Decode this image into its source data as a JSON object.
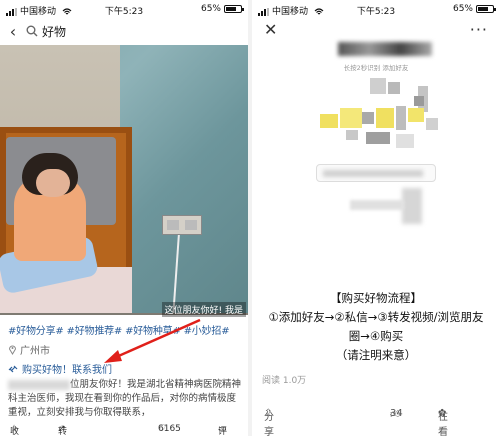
{
  "left": {
    "status": {
      "carrier": "中国移动",
      "time": "下午5:23",
      "battery": "65%"
    },
    "search": {
      "query": "好物"
    },
    "photo": {
      "caption": "这位朋友你好! 我是"
    },
    "tags": "#好物分享# #好物推荐# #好物种草# #小妙招#",
    "location": "广州市",
    "buy_link": "购买好物！联系我们",
    "description": "位朋友你好！我是湖北省精神病医院精神科主治医师，我现在看到你的作品后，对你的病情极度重视，立刻安排我与你取得联系，",
    "footer": {
      "favorite": "收藏",
      "share": "转发",
      "likes": "6165",
      "comments": "评"
    }
  },
  "right": {
    "status": {
      "carrier": "中国移动",
      "time": "下午5:23",
      "battery": "65%"
    },
    "ad_subtitle": "长按2秒识别    添加好友",
    "flow": {
      "title": "【购买好物流程】",
      "line1": "①添加好友→②私信→③转发视频/浏览朋友",
      "line2": "圈→④购买",
      "line3": "（请注明来意）"
    },
    "reads": "阅读 1.0万",
    "footer": {
      "share": "分享",
      "likes": "34",
      "watching": "在看 55"
    }
  },
  "colors": {
    "link": "#2b5e9a",
    "arrow": "#e0201a",
    "mosaic_yellow": "#f0e060"
  },
  "icons": [
    "back-icon",
    "search-icon",
    "location-icon",
    "link-icon",
    "star-icon",
    "share-icon",
    "heart-icon",
    "comment-icon",
    "close-icon",
    "more-icon",
    "like-icon",
    "watching-icon",
    "signal-icon",
    "wifi-icon",
    "battery-icon"
  ]
}
